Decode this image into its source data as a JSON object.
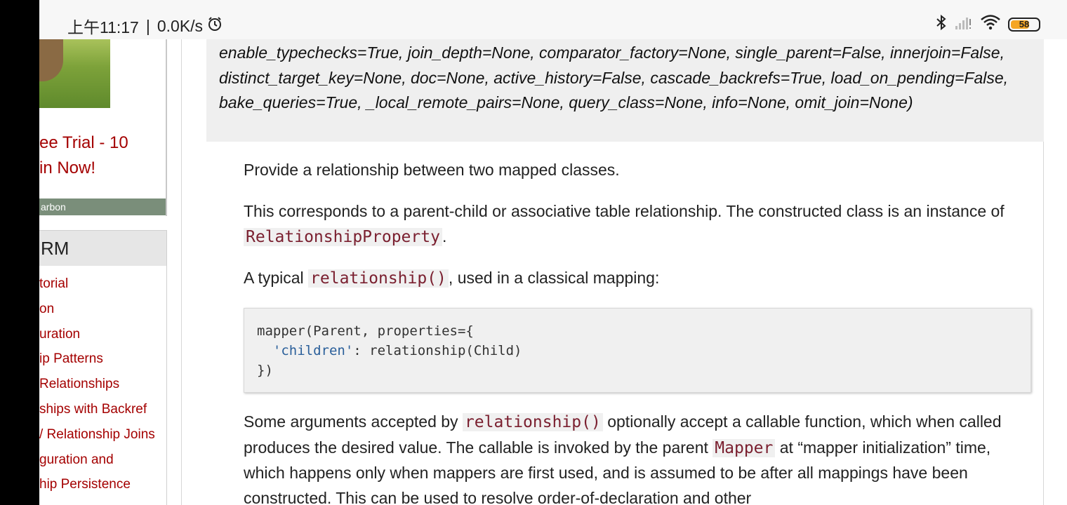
{
  "status_bar": {
    "time": "上午11:17",
    "separator": "|",
    "speed": "0.0K/s",
    "battery": "58",
    "colors": {
      "battery_fill": "#f5a623"
    },
    "icons": [
      "alarm-icon",
      "bluetooth-icon",
      "signal-icon",
      "wifi-icon",
      "battery-icon"
    ]
  },
  "sidebar": {
    "ad": {
      "line1": "ee Trial - 10",
      "line2": "in Now!",
      "footer": "arbon"
    },
    "orm": {
      "header": "RM",
      "items": [
        "torial",
        "on",
        "uration",
        "ip Patterns",
        "Relationships",
        "ships with Backref",
        "/ Relationship Joins",
        "guration and",
        "hip Persistence"
      ]
    }
  },
  "content": {
    "signature": "enable_typechecks=True, join_depth=None, comparator_factory=None, single_parent=False, innerjoin=False, distinct_target_key=None, doc=None, active_history=False, cascade_backrefs=True, load_on_pending=False, bake_queries=True, _local_remote_pairs=None, query_class=None, info=None, omit_join=None)",
    "p1": "Provide a relationship between two mapped classes.",
    "p2_before": "This corresponds to a parent-child or associative table relationship. The constructed class is an instance of ",
    "p2_code": "RelationshipProperty",
    "p2_after": ".",
    "p3_before": "A typical ",
    "p3_code": "relationship()",
    "p3_after": ", used in a classical mapping:",
    "code_block": {
      "line1": "mapper(Parent, properties={",
      "line2_indent": "  ",
      "line2_str": "'children'",
      "line2_rest": ": relationship(Child)",
      "line3": "})"
    },
    "p4_before": "Some arguments accepted by ",
    "p4_code1": "relationship()",
    "p4_mid": " optionally accept a callable function, which when called produces the desired value. The callable is invoked by the parent ",
    "p4_code2": "Mapper",
    "p4_after": " at “mapper initialization” time, which happens only when mappers are first used, and is assumed to be after all mappings have been constructed. This can be used to resolve order-of-declaration and other"
  },
  "colors": {
    "link": "#a40000",
    "code_text": "#7a1f2f",
    "code_string": "#2a5f9a",
    "signature_bg": "#efefef"
  }
}
